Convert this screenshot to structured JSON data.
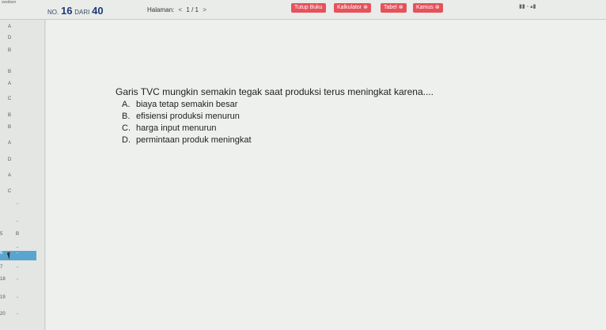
{
  "header": {
    "corner_tag": "swafasn",
    "question_no_prefix": "NO.",
    "question_no": "16",
    "of_label": "DARI",
    "total": "40",
    "page_label": "Halaman:",
    "page_prev": "<",
    "page_value": "1 / 1",
    "page_next": ">",
    "buttons": {
      "tutup_buku": "Tutup Buku",
      "kalkulator": "Kalkulator",
      "tabel": "Tabel",
      "kamus": "Kamus"
    },
    "close_glyph": "⊗",
    "right_status": "▮▮  ◦  ▴▮"
  },
  "sidebar": {
    "letters": [
      {
        "label": "A"
      },
      {
        "label": "D"
      },
      {
        "label": "B"
      },
      {
        "label": "B"
      },
      {
        "label": "A"
      },
      {
        "label": "C"
      },
      {
        "label": "B"
      },
      {
        "label": "B"
      },
      {
        "label": "A"
      },
      {
        "label": "D"
      },
      {
        "label": "A"
      },
      {
        "label": "C"
      }
    ],
    "numbered": [
      {
        "num": "",
        "label": "-"
      },
      {
        "num": "",
        "label": "-"
      },
      {
        "num": "5",
        "label": "B"
      },
      {
        "num": "",
        "label": "-"
      },
      {
        "num": "6",
        "label": "-",
        "active": true
      },
      {
        "num": "7",
        "label": "-"
      },
      {
        "num": "18",
        "label": "-"
      },
      {
        "num": "19",
        "label": "-"
      },
      {
        "num": "20",
        "label": "-"
      }
    ]
  },
  "question": {
    "text": "Garis TVC mungkin semakin tegak saat produksi terus meningkat karena....",
    "options": [
      {
        "key": "A.",
        "text": "biaya tetap semakin besar"
      },
      {
        "key": "B.",
        "text": "efisiensi produksi menurun"
      },
      {
        "key": "C.",
        "text": "harga input menurun"
      },
      {
        "key": "D.",
        "text": "permintaan produk meningkat"
      }
    ]
  }
}
